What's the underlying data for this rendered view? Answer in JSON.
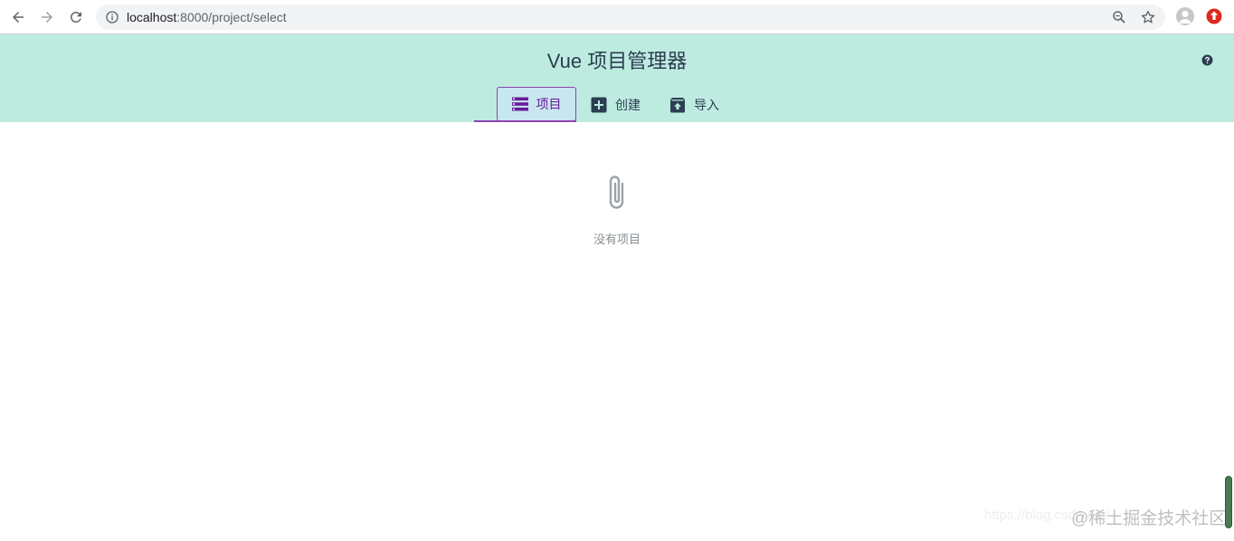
{
  "browser": {
    "url_host": "localhost",
    "url_path": ":8000/project/select",
    "icons": {
      "back": "arrow-left-icon",
      "forward": "arrow-right-icon",
      "reload": "reload-icon",
      "info": "info-icon",
      "zoom": "zoom-icon",
      "star": "star-icon",
      "profile": "avatar-icon",
      "extension": "extension-icon"
    }
  },
  "header": {
    "title": "Vue 项目管理器",
    "bg_color": "#bdebe0",
    "help_icon": "help-icon"
  },
  "tabs": [
    {
      "label": "项目",
      "icon": "list-icon",
      "active": true
    },
    {
      "label": "创建",
      "icon": "add-box-icon",
      "active": false
    },
    {
      "label": "导入",
      "icon": "unarchive-icon",
      "active": false
    }
  ],
  "main": {
    "empty_icon": "paperclip-icon",
    "empty_text": "没有项目"
  },
  "watermark": {
    "url_text": "https://blog.csdn.net/",
    "brand_text": "@稀土掘金技术社区"
  },
  "colors": {
    "accent": "#8e44ad",
    "text": "#2c3e50",
    "muted": "#8a8f94"
  }
}
